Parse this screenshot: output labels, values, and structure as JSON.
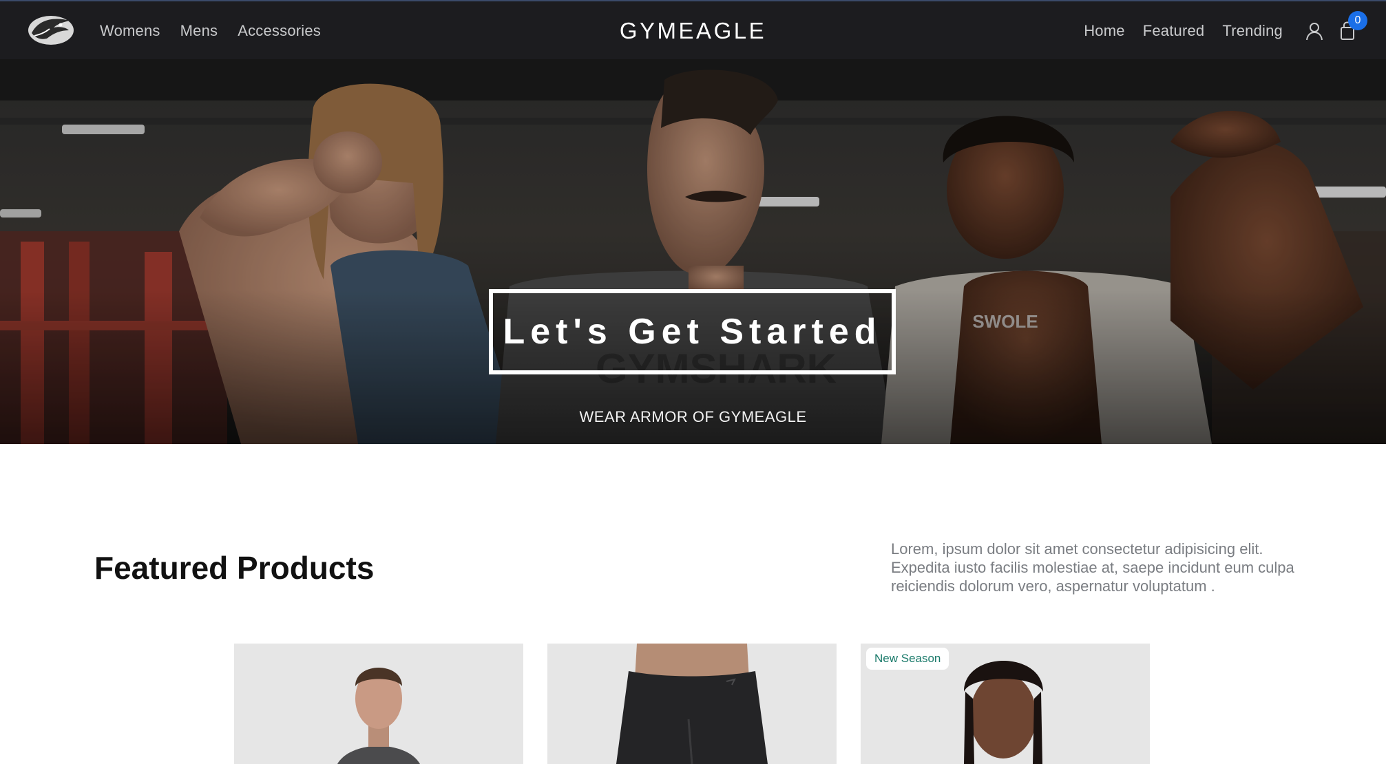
{
  "header": {
    "brand": "GYMEAGLE",
    "logo_icon": "eagle-logo-icon",
    "nav_left": [
      "Womens",
      "Mens",
      "Accessories"
    ],
    "nav_right": [
      "Home",
      "Featured",
      "Trending"
    ],
    "account_icon": "user-icon",
    "cart_icon": "shopping-bag-icon",
    "cart_count": "0",
    "colors": {
      "background": "#1c1c1f",
      "badge": "#1a6fe8"
    }
  },
  "hero": {
    "cta_label": "Let's Get Started",
    "subtitle": "WEAR ARMOR OF GYMEAGLE"
  },
  "featured": {
    "title": "Featured Products",
    "description": "Lorem, ipsum dolor sit amet consectetur adipisicing elit. Expedita iusto facilis molestiae at, saepe incidunt eum culpa reiciendis dolorum vero, aspernatur voluptatum .",
    "products": [
      {
        "badge": ""
      },
      {
        "badge": ""
      },
      {
        "badge": "New Season"
      }
    ]
  }
}
